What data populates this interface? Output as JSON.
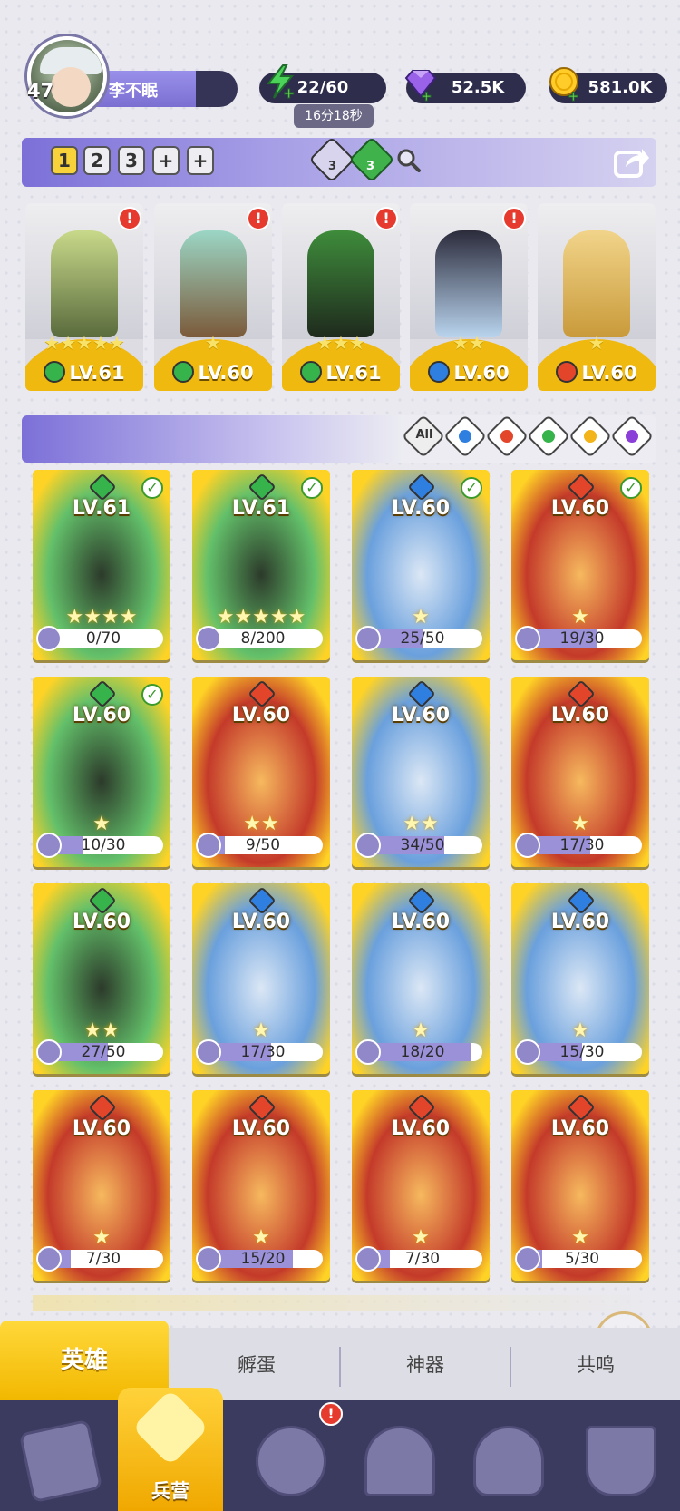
{
  "player": {
    "level": "47",
    "name": "李不眠"
  },
  "resources": {
    "energy": "22/60",
    "energy_timer": "16分18秒",
    "gems": "52.5K",
    "gold": "581.0K"
  },
  "team_tabs": [
    "1",
    "2",
    "3",
    "+",
    "+"
  ],
  "team_selected": "1",
  "crystals": {
    "purple_count": "3",
    "green_count": "3"
  },
  "team_heroes": [
    {
      "level": "LV.61",
      "stars": "★★★★★",
      "element": "wind",
      "alert": "!"
    },
    {
      "level": "LV.60",
      "stars": "★",
      "element": "wind",
      "alert": "!"
    },
    {
      "level": "LV.61",
      "stars": "★★★",
      "element": "wind",
      "alert": "!"
    },
    {
      "level": "LV.60",
      "stars": "★★",
      "element": "water",
      "alert": "!"
    },
    {
      "level": "LV.60",
      "stars": "★",
      "element": "fire",
      "alert": ""
    }
  ],
  "filters": {
    "all_label": "All",
    "elements": [
      "water",
      "fire",
      "wind",
      "light",
      "dark"
    ]
  },
  "heroes": [
    {
      "level": "LV.61",
      "element": "wind",
      "check": "✓",
      "stars": "★★★★",
      "progress": "0/70",
      "fill": 0.0
    },
    {
      "level": "LV.61",
      "element": "wind",
      "check": "✓",
      "stars": "★★★★★",
      "progress": "8/200",
      "fill": 0.04
    },
    {
      "level": "LV.60",
      "element": "water",
      "check": "✓",
      "stars": "★",
      "progress": "25/50",
      "fill": 0.5
    },
    {
      "level": "LV.60",
      "element": "fire",
      "check": "✓",
      "stars": "★",
      "progress": "19/30",
      "fill": 0.63
    },
    {
      "level": "LV.60",
      "element": "wind",
      "check": "✓",
      "stars": "★",
      "progress": "10/30",
      "fill": 0.33
    },
    {
      "level": "LV.60",
      "element": "fire",
      "check": "",
      "stars": "★★",
      "progress": "9/50",
      "fill": 0.18
    },
    {
      "level": "LV.60",
      "element": "water",
      "check": "",
      "stars": "★★",
      "progress": "34/50",
      "fill": 0.68
    },
    {
      "level": "LV.60",
      "element": "fire",
      "check": "",
      "stars": "★",
      "progress": "17/30",
      "fill": 0.57
    },
    {
      "level": "LV.60",
      "element": "wind",
      "check": "",
      "stars": "★★",
      "progress": "27/50",
      "fill": 0.54
    },
    {
      "level": "LV.60",
      "element": "water",
      "check": "",
      "stars": "★",
      "progress": "17/30",
      "fill": 0.57
    },
    {
      "level": "LV.60",
      "element": "water",
      "check": "",
      "stars": "★",
      "progress": "18/20",
      "fill": 0.9
    },
    {
      "level": "LV.60",
      "element": "water",
      "check": "",
      "stars": "★",
      "progress": "15/30",
      "fill": 0.5
    },
    {
      "level": "LV.60",
      "element": "fire",
      "check": "",
      "stars": "★",
      "progress": "7/30",
      "fill": 0.23
    },
    {
      "level": "LV.60",
      "element": "fire",
      "check": "",
      "stars": "★",
      "progress": "15/20",
      "fill": 0.75
    },
    {
      "level": "LV.60",
      "element": "fire",
      "check": "",
      "stars": "★",
      "progress": "7/30",
      "fill": 0.23
    },
    {
      "level": "LV.60",
      "element": "fire",
      "check": "",
      "stars": "★",
      "progress": "5/30",
      "fill": 0.17
    }
  ],
  "subnav": {
    "hero": "英雄",
    "hatch": "孵蛋",
    "artifact": "神器",
    "resonance": "共鸣"
  },
  "bottom_nav": {
    "barracks": "兵营",
    "alert": "!"
  },
  "colors": {
    "wind": "#36b34a",
    "water": "#2f7fe0",
    "fire": "#e3452b",
    "light": "#f2b418",
    "dark": "#8b3fd9",
    "gold": "#ffd326"
  }
}
